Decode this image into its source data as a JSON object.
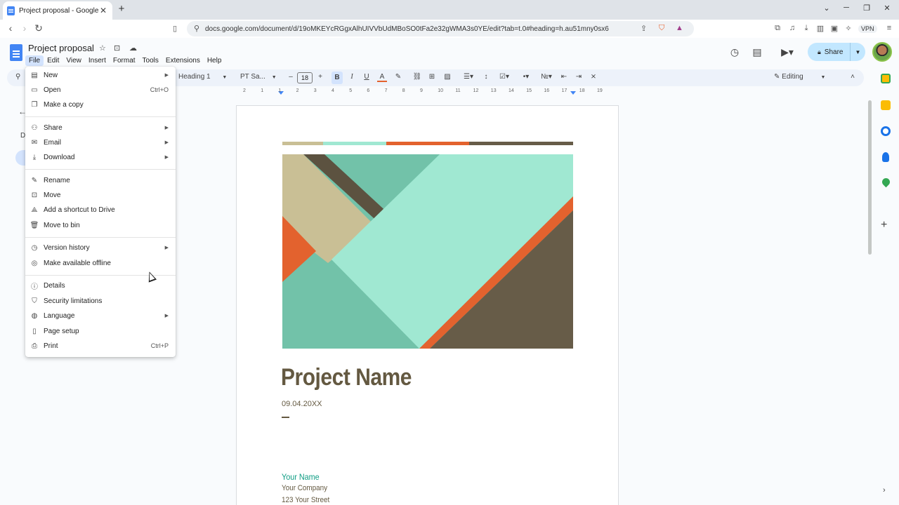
{
  "browser": {
    "tab_title": "Project proposal - Google Docs",
    "new_tab": "+",
    "url": "docs.google.com/document/d/19oMKEYcRGgxAlhUIVVbUdMBoSO0tFa2e32gWMA3s0YE/edit?tab=t.0#heading=h.au51mny0sx6",
    "vpn_label": "VPN"
  },
  "header": {
    "doc_title": "Project proposal",
    "menu": [
      "File",
      "Edit",
      "View",
      "Insert",
      "Format",
      "Tools",
      "Extensions",
      "Help"
    ],
    "share_label": "Share"
  },
  "toolbar": {
    "style": "Heading 1",
    "font": "PT Sa...",
    "font_size": "18",
    "mode": "Editing"
  },
  "ruler_labels": [
    "2",
    "1",
    "1",
    "2",
    "3",
    "4",
    "5",
    "6",
    "7",
    "8",
    "9",
    "10",
    "11",
    "12",
    "13",
    "14",
    "15",
    "16",
    "17",
    "18",
    "19"
  ],
  "outline_fragment": "D",
  "file_menu": {
    "items": [
      {
        "label": "New",
        "icon": "doc-icon",
        "shortcut": "",
        "submenu": true
      },
      {
        "label": "Open",
        "icon": "folder-icon",
        "shortcut": "Ctrl+O",
        "submenu": false
      },
      {
        "label": "Make a copy",
        "icon": "copy-icon",
        "shortcut": "",
        "submenu": false
      },
      {
        "label": "Share",
        "icon": "person-add-icon",
        "shortcut": "",
        "submenu": true
      },
      {
        "label": "Email",
        "icon": "mail-icon",
        "shortcut": "",
        "submenu": true
      },
      {
        "label": "Download",
        "icon": "download-icon",
        "shortcut": "",
        "submenu": true
      },
      {
        "label": "Rename",
        "icon": "pencil-icon",
        "shortcut": "",
        "submenu": false
      },
      {
        "label": "Move",
        "icon": "move-folder-icon",
        "shortcut": "",
        "submenu": false
      },
      {
        "label": "Add a shortcut to Drive",
        "icon": "drive-shortcut-icon",
        "shortcut": "",
        "submenu": false
      },
      {
        "label": "Move to bin",
        "icon": "trash-icon",
        "shortcut": "",
        "submenu": false
      },
      {
        "label": "Version history",
        "icon": "history-icon",
        "shortcut": "",
        "submenu": true
      },
      {
        "label": "Make available offline",
        "icon": "offline-icon",
        "shortcut": "",
        "submenu": false
      },
      {
        "label": "Details",
        "icon": "info-icon",
        "shortcut": "",
        "submenu": false
      },
      {
        "label": "Security limitations",
        "icon": "shield-icon",
        "shortcut": "",
        "submenu": false
      },
      {
        "label": "Language",
        "icon": "globe-icon",
        "shortcut": "",
        "submenu": true
      },
      {
        "label": "Page setup",
        "icon": "page-icon",
        "shortcut": "",
        "submenu": false
      },
      {
        "label": "Print",
        "icon": "printer-icon",
        "shortcut": "Ctrl+P",
        "submenu": false
      }
    ]
  },
  "document": {
    "project_name": "Project Name",
    "date": "09.04.20XX",
    "your_name": "Your Name",
    "your_company": "Your Company",
    "your_street": "123 Your Street"
  },
  "colors": {
    "accent_blue": "#4285f4",
    "share_bg": "#c2e7ff",
    "title_brown": "#645941",
    "teal": "#0f9d84",
    "mint": "#a0e8d2",
    "sand": "#c9bf95",
    "orange": "#e3622e",
    "dark_brown": "#675c48",
    "sea": "#72c2a9"
  }
}
